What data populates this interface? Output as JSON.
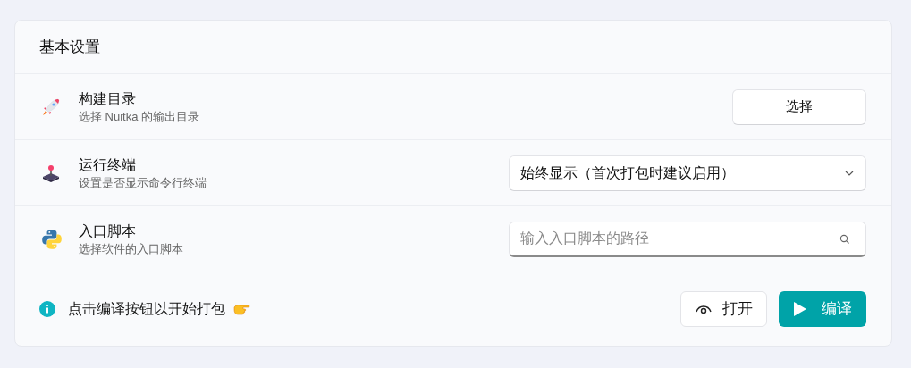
{
  "card": {
    "title": "基本设置"
  },
  "rows": [
    {
      "title": "构建目录",
      "subtitle": "选择 Nuitka 的输出目录",
      "control": {
        "kind": "button",
        "label": "选择"
      }
    },
    {
      "title": "运行终端",
      "subtitle": "设置是否显示命令行终端",
      "control": {
        "kind": "select",
        "value": "始终显示（首次打包时建议启用）"
      }
    },
    {
      "title": "入口脚本",
      "subtitle": "选择软件的入口脚本",
      "control": {
        "kind": "search",
        "placeholder": "输入入口脚本的路径"
      }
    }
  ],
  "footer": {
    "hint": "点击编译按钮以开始打包",
    "buttons": [
      {
        "kind": "secondary",
        "label": "打开"
      },
      {
        "kind": "primary",
        "label": "编译"
      }
    ]
  }
}
